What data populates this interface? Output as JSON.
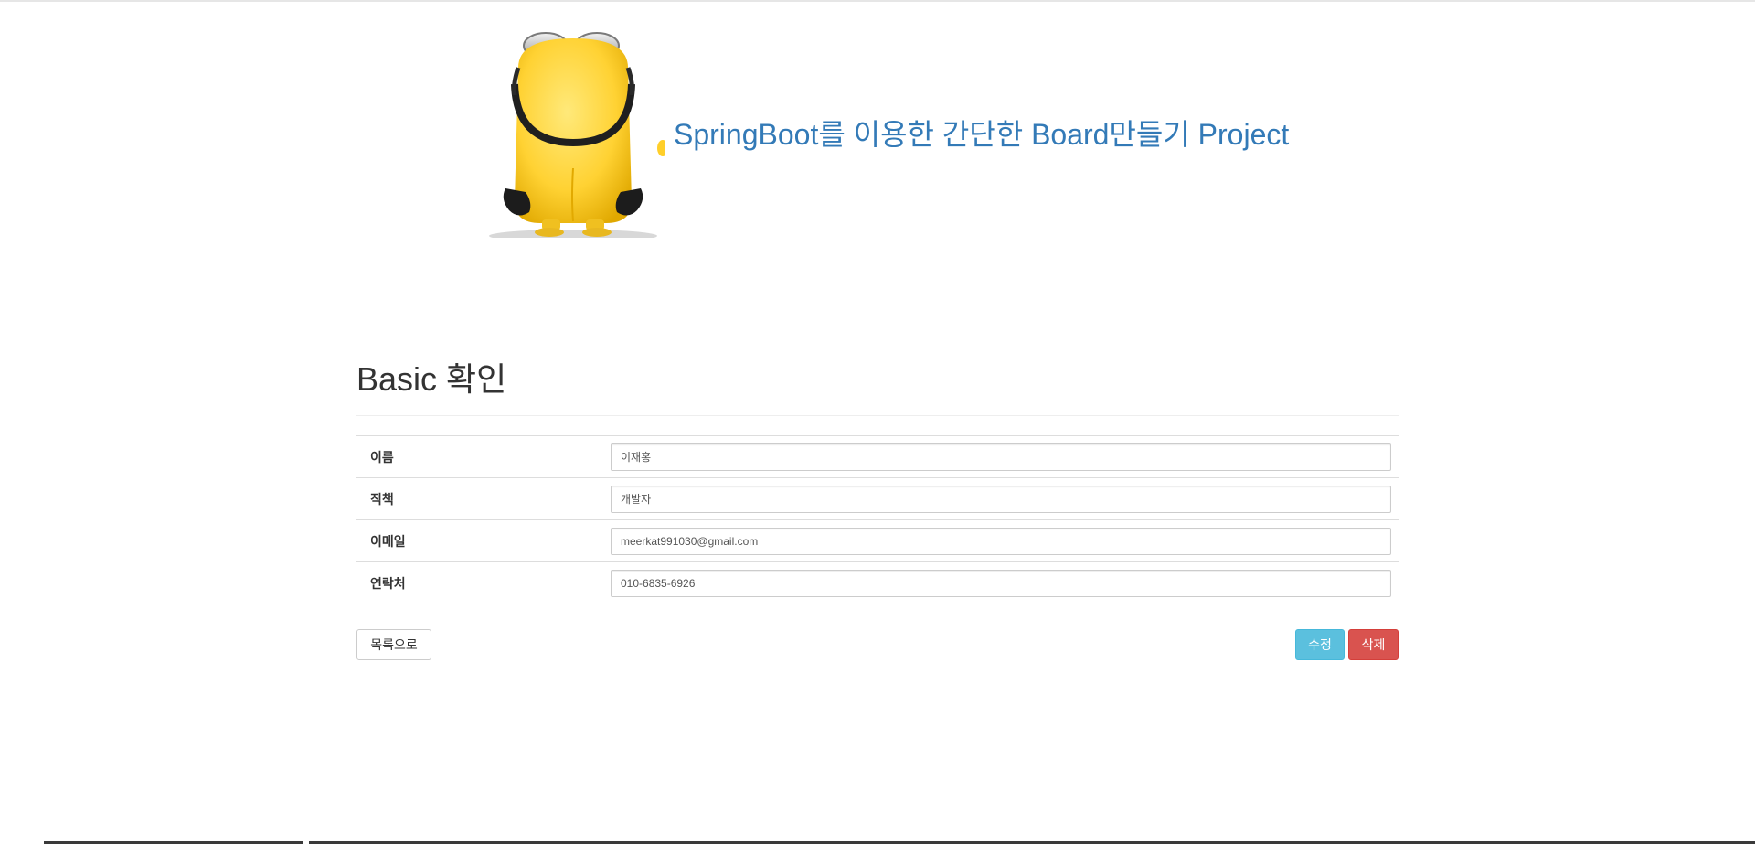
{
  "header": {
    "logo_name": "minion-mascot",
    "title": "SpringBoot를 이용한 간단한 Board만들기 Project"
  },
  "page": {
    "title": "Basic 확인"
  },
  "fields": [
    {
      "label": "이름",
      "value": "이재홍"
    },
    {
      "label": "직책",
      "value": "개발자"
    },
    {
      "label": "이메일",
      "value": "meerkat991030@gmail.com"
    },
    {
      "label": "연락처",
      "value": "010-6835-6926"
    }
  ],
  "actions": {
    "list_label": "목록으로",
    "edit_label": "수정",
    "delete_label": "삭제"
  },
  "colors": {
    "title_link": "#337ab7",
    "edit_button": "#5bc0de",
    "delete_button": "#d9534f"
  }
}
